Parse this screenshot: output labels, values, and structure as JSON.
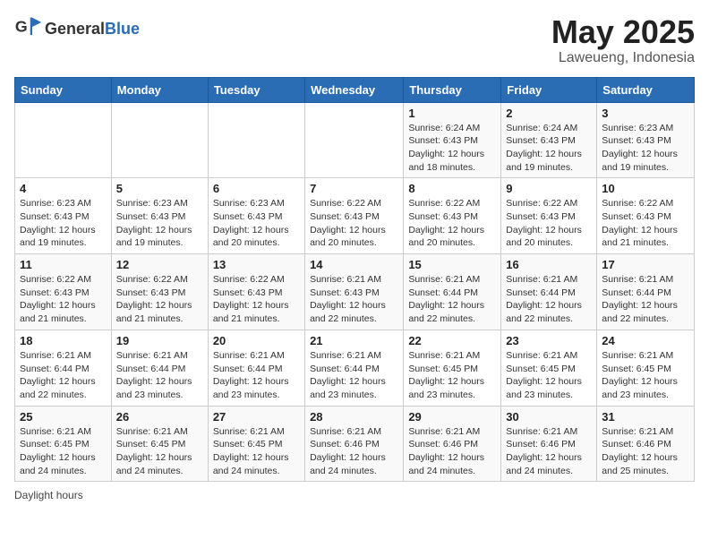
{
  "logo": {
    "text_general": "General",
    "text_blue": "Blue"
  },
  "header": {
    "month": "May 2025",
    "location": "Laweueng, Indonesia"
  },
  "weekdays": [
    "Sunday",
    "Monday",
    "Tuesday",
    "Wednesday",
    "Thursday",
    "Friday",
    "Saturday"
  ],
  "weeks": [
    [
      {
        "day": "",
        "info": ""
      },
      {
        "day": "",
        "info": ""
      },
      {
        "day": "",
        "info": ""
      },
      {
        "day": "",
        "info": ""
      },
      {
        "day": "1",
        "info": "Sunrise: 6:24 AM\nSunset: 6:43 PM\nDaylight: 12 hours and 18 minutes."
      },
      {
        "day": "2",
        "info": "Sunrise: 6:24 AM\nSunset: 6:43 PM\nDaylight: 12 hours and 19 minutes."
      },
      {
        "day": "3",
        "info": "Sunrise: 6:23 AM\nSunset: 6:43 PM\nDaylight: 12 hours and 19 minutes."
      }
    ],
    [
      {
        "day": "4",
        "info": "Sunrise: 6:23 AM\nSunset: 6:43 PM\nDaylight: 12 hours and 19 minutes."
      },
      {
        "day": "5",
        "info": "Sunrise: 6:23 AM\nSunset: 6:43 PM\nDaylight: 12 hours and 19 minutes."
      },
      {
        "day": "6",
        "info": "Sunrise: 6:23 AM\nSunset: 6:43 PM\nDaylight: 12 hours and 20 minutes."
      },
      {
        "day": "7",
        "info": "Sunrise: 6:22 AM\nSunset: 6:43 PM\nDaylight: 12 hours and 20 minutes."
      },
      {
        "day": "8",
        "info": "Sunrise: 6:22 AM\nSunset: 6:43 PM\nDaylight: 12 hours and 20 minutes."
      },
      {
        "day": "9",
        "info": "Sunrise: 6:22 AM\nSunset: 6:43 PM\nDaylight: 12 hours and 20 minutes."
      },
      {
        "day": "10",
        "info": "Sunrise: 6:22 AM\nSunset: 6:43 PM\nDaylight: 12 hours and 21 minutes."
      }
    ],
    [
      {
        "day": "11",
        "info": "Sunrise: 6:22 AM\nSunset: 6:43 PM\nDaylight: 12 hours and 21 minutes."
      },
      {
        "day": "12",
        "info": "Sunrise: 6:22 AM\nSunset: 6:43 PM\nDaylight: 12 hours and 21 minutes."
      },
      {
        "day": "13",
        "info": "Sunrise: 6:22 AM\nSunset: 6:43 PM\nDaylight: 12 hours and 21 minutes."
      },
      {
        "day": "14",
        "info": "Sunrise: 6:21 AM\nSunset: 6:43 PM\nDaylight: 12 hours and 22 minutes."
      },
      {
        "day": "15",
        "info": "Sunrise: 6:21 AM\nSunset: 6:44 PM\nDaylight: 12 hours and 22 minutes."
      },
      {
        "day": "16",
        "info": "Sunrise: 6:21 AM\nSunset: 6:44 PM\nDaylight: 12 hours and 22 minutes."
      },
      {
        "day": "17",
        "info": "Sunrise: 6:21 AM\nSunset: 6:44 PM\nDaylight: 12 hours and 22 minutes."
      }
    ],
    [
      {
        "day": "18",
        "info": "Sunrise: 6:21 AM\nSunset: 6:44 PM\nDaylight: 12 hours and 22 minutes."
      },
      {
        "day": "19",
        "info": "Sunrise: 6:21 AM\nSunset: 6:44 PM\nDaylight: 12 hours and 23 minutes."
      },
      {
        "day": "20",
        "info": "Sunrise: 6:21 AM\nSunset: 6:44 PM\nDaylight: 12 hours and 23 minutes."
      },
      {
        "day": "21",
        "info": "Sunrise: 6:21 AM\nSunset: 6:44 PM\nDaylight: 12 hours and 23 minutes."
      },
      {
        "day": "22",
        "info": "Sunrise: 6:21 AM\nSunset: 6:45 PM\nDaylight: 12 hours and 23 minutes."
      },
      {
        "day": "23",
        "info": "Sunrise: 6:21 AM\nSunset: 6:45 PM\nDaylight: 12 hours and 23 minutes."
      },
      {
        "day": "24",
        "info": "Sunrise: 6:21 AM\nSunset: 6:45 PM\nDaylight: 12 hours and 23 minutes."
      }
    ],
    [
      {
        "day": "25",
        "info": "Sunrise: 6:21 AM\nSunset: 6:45 PM\nDaylight: 12 hours and 24 minutes."
      },
      {
        "day": "26",
        "info": "Sunrise: 6:21 AM\nSunset: 6:45 PM\nDaylight: 12 hours and 24 minutes."
      },
      {
        "day": "27",
        "info": "Sunrise: 6:21 AM\nSunset: 6:45 PM\nDaylight: 12 hours and 24 minutes."
      },
      {
        "day": "28",
        "info": "Sunrise: 6:21 AM\nSunset: 6:46 PM\nDaylight: 12 hours and 24 minutes."
      },
      {
        "day": "29",
        "info": "Sunrise: 6:21 AM\nSunset: 6:46 PM\nDaylight: 12 hours and 24 minutes."
      },
      {
        "day": "30",
        "info": "Sunrise: 6:21 AM\nSunset: 6:46 PM\nDaylight: 12 hours and 24 minutes."
      },
      {
        "day": "31",
        "info": "Sunrise: 6:21 AM\nSunset: 6:46 PM\nDaylight: 12 hours and 25 minutes."
      }
    ]
  ],
  "footer": {
    "note": "Daylight hours"
  }
}
